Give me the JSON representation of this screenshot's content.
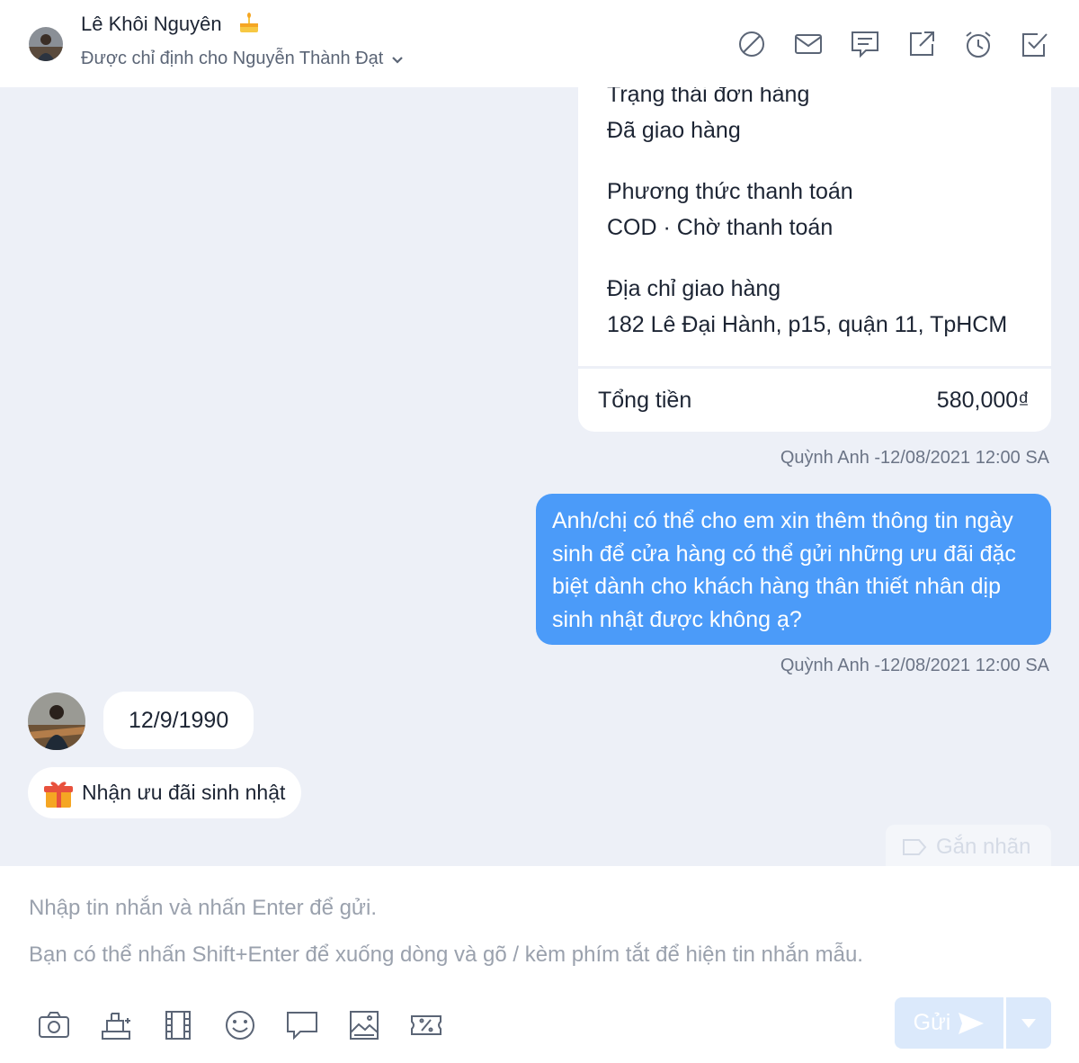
{
  "header": {
    "customer_name": "Lê Khôi Nguyên",
    "assignment": "Được chỉ định cho Nguyễn Thành Đạt",
    "actions": [
      {
        "name": "block-icon"
      },
      {
        "name": "mail-icon"
      },
      {
        "name": "message-note-icon"
      },
      {
        "name": "open-external-icon"
      },
      {
        "name": "alarm-icon"
      },
      {
        "name": "check-square-icon"
      }
    ]
  },
  "order": {
    "status_label": "Trạng thái đơn hàng",
    "status_value": "Đã giao hàng",
    "payment_label": "Phương thức thanh toán",
    "payment_value": "COD · Chờ thanh toán",
    "address_label": "Địa chỉ giao hàng",
    "address_value": "182 Lê Đại Hành, p15, quận 11, TpHCM",
    "total_label": "Tổng tiền",
    "total_value": "580,000₫"
  },
  "messages": {
    "card_meta": "Quỳnh Anh -12/08/2021 12:00 SA",
    "outgoing_text": "Anh/chị có thể cho em xin thêm thông tin ngày sinh để cửa hàng có thể gửi những ưu đãi đặc biệt dành cho khách hàng thân thiết nhân dịp sinh nhật được không ạ?",
    "outgoing_meta": "Quỳnh Anh -12/08/2021 12:00 SA",
    "incoming_text": "12/9/1990"
  },
  "quick_action": {
    "label": "Nhận ưu đãi sinh nhật",
    "icon": "gift-icon"
  },
  "tag_button": {
    "label": "Gắn nhãn"
  },
  "composer": {
    "placeholder_line1": "Nhập tin nhắn và nhấn Enter để gửi.",
    "placeholder_line2": "Bạn có thể nhấn Shift+Enter để xuống dòng và gõ / kèm phím tắt để hiện tin nhắn mẫu.",
    "tools": [
      "camera-icon",
      "product-icon",
      "video-icon",
      "emoji-icon",
      "quick-reply-icon",
      "image-icon",
      "coupon-icon"
    ],
    "send_label": "Gửi"
  },
  "colors": {
    "accent": "#4b9bf9",
    "background": "#edf0f7",
    "send_disabled": "#dbe9fb"
  }
}
